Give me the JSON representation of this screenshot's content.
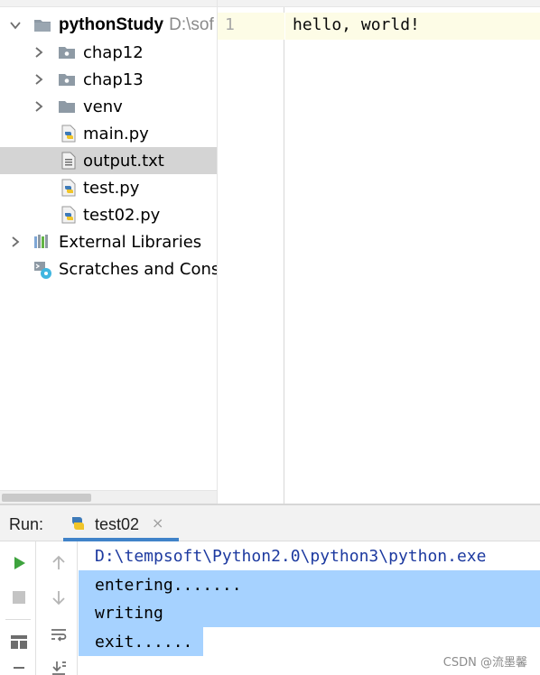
{
  "project_tree": {
    "root": {
      "name": "pythonStudy",
      "path": "D:\\sof"
    },
    "items": [
      {
        "label": "chap12",
        "kind": "folder",
        "expandable": true
      },
      {
        "label": "chap13",
        "kind": "folder",
        "expandable": true
      },
      {
        "label": "venv",
        "kind": "folder",
        "expandable": true
      },
      {
        "label": "main.py",
        "kind": "python-file"
      },
      {
        "label": "output.txt",
        "kind": "text-file",
        "selected": true
      },
      {
        "label": "test.py",
        "kind": "python-file"
      },
      {
        "label": "test02.py",
        "kind": "python-file"
      }
    ],
    "external_libraries": "External Libraries",
    "scratches": "Scratches and Conso"
  },
  "editor": {
    "line_number": "1",
    "content": "hello, world!"
  },
  "run_panel": {
    "title": "Run:",
    "tab_label": "test02",
    "close_symbol": "×",
    "console_lines": [
      "D:\\tempsoft\\Python2.0\\python3\\python.exe",
      "entering.......",
      "writing",
      "exit......"
    ]
  },
  "watermark": "CSDN @流墨馨",
  "colors": {
    "selection": "#a6d2ff",
    "tree_selected": "#d4d4d4",
    "current_line": "#fdfce6",
    "tab_underline": "#4083c9",
    "run_green": "#3ea33e"
  }
}
